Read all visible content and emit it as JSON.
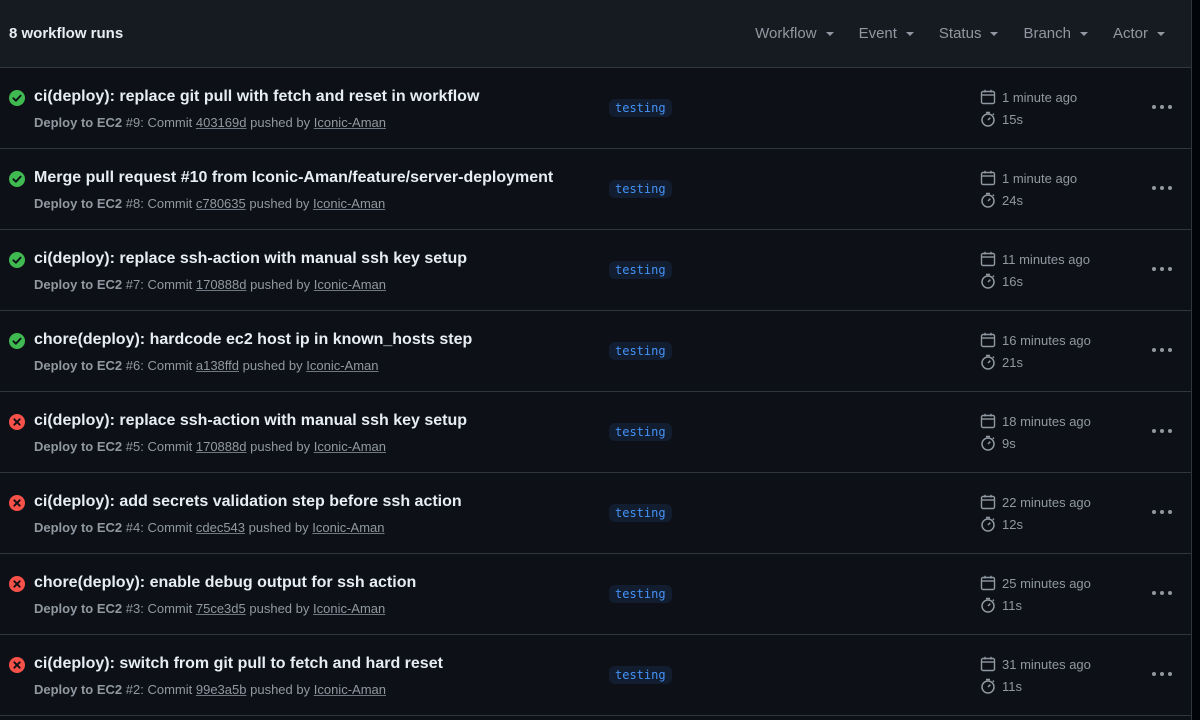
{
  "header": {
    "title": "8 workflow runs",
    "filters": [
      "Workflow",
      "Event",
      "Status",
      "Branch",
      "Actor"
    ]
  },
  "colors": {
    "success": "#3fb950",
    "failure": "#f85149",
    "branch_text": "#4493f8"
  },
  "runs": [
    {
      "status": "success",
      "title": "ci(deploy): replace git pull with fetch and reset in workflow",
      "workflow": "Deploy to EC2",
      "run_number": "#9",
      "commit_label": "Commit",
      "commit": "403169d",
      "pushed_by": "pushed by",
      "actor": "Iconic-Aman",
      "branch": "testing",
      "time_ago": "1 minute ago",
      "duration": "15s"
    },
    {
      "status": "success",
      "title": "Merge pull request #10 from Iconic-Aman/feature/server-deployment",
      "workflow": "Deploy to EC2",
      "run_number": "#8",
      "commit_label": "Commit",
      "commit": "c780635",
      "pushed_by": "pushed by",
      "actor": "Iconic-Aman",
      "branch": "testing",
      "time_ago": "1 minute ago",
      "duration": "24s"
    },
    {
      "status": "success",
      "title": "ci(deploy): replace ssh-action with manual ssh key setup",
      "workflow": "Deploy to EC2",
      "run_number": "#7",
      "commit_label": "Commit",
      "commit": "170888d",
      "pushed_by": "pushed by",
      "actor": "Iconic-Aman",
      "branch": "testing",
      "time_ago": "11 minutes ago",
      "duration": "16s"
    },
    {
      "status": "success",
      "title": "chore(deploy): hardcode ec2 host ip in known_hosts step",
      "workflow": "Deploy to EC2",
      "run_number": "#6",
      "commit_label": "Commit",
      "commit": "a138ffd",
      "pushed_by": "pushed by",
      "actor": "Iconic-Aman",
      "branch": "testing",
      "time_ago": "16 minutes ago",
      "duration": "21s"
    },
    {
      "status": "failure",
      "title": "ci(deploy): replace ssh-action with manual ssh key setup",
      "workflow": "Deploy to EC2",
      "run_number": "#5",
      "commit_label": "Commit",
      "commit": "170888d",
      "pushed_by": "pushed by",
      "actor": "Iconic-Aman",
      "branch": "testing",
      "time_ago": "18 minutes ago",
      "duration": "9s"
    },
    {
      "status": "failure",
      "title": "ci(deploy): add secrets validation step before ssh action",
      "workflow": "Deploy to EC2",
      "run_number": "#4",
      "commit_label": "Commit",
      "commit": "cdec543",
      "pushed_by": "pushed by",
      "actor": "Iconic-Aman",
      "branch": "testing",
      "time_ago": "22 minutes ago",
      "duration": "12s"
    },
    {
      "status": "failure",
      "title": "chore(deploy): enable debug output for ssh action",
      "workflow": "Deploy to EC2",
      "run_number": "#3",
      "commit_label": "Commit",
      "commit": "75ce3d5",
      "pushed_by": "pushed by",
      "actor": "Iconic-Aman",
      "branch": "testing",
      "time_ago": "25 minutes ago",
      "duration": "11s"
    },
    {
      "status": "failure",
      "title": "ci(deploy): switch from git pull to fetch and hard reset",
      "workflow": "Deploy to EC2",
      "run_number": "#2",
      "commit_label": "Commit",
      "commit": "99e3a5b",
      "pushed_by": "pushed by",
      "actor": "Iconic-Aman",
      "branch": "testing",
      "time_ago": "31 minutes ago",
      "duration": "11s"
    }
  ]
}
